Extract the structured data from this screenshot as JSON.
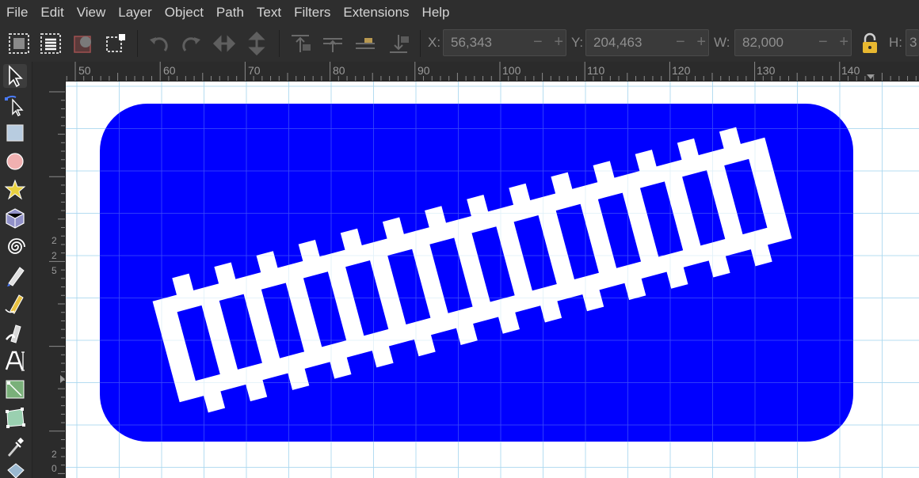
{
  "menu": [
    "File",
    "Edit",
    "View",
    "Layer",
    "Object",
    "Path",
    "Text",
    "Filters",
    "Extensions",
    "Help"
  ],
  "toolbar": {
    "x_label": "X:",
    "x_value": "56,343",
    "y_label": "Y:",
    "y_value": "204,463",
    "w_label": "W:",
    "w_value": "82,000",
    "h_label": "H:",
    "h_value": "3"
  },
  "ruler": {
    "horizontal_labels": [
      "50",
      "60",
      "70",
      "80",
      "90",
      "100",
      "110",
      "120",
      "130",
      "140"
    ],
    "vertical_labels_top": [
      "2",
      "2",
      "5"
    ],
    "vertical_labels_bottom": [
      "2",
      "0"
    ]
  },
  "tools": [
    "selector-tool",
    "node-tool",
    "rectangle-tool",
    "ellipse-tool",
    "star-tool",
    "box3d-tool",
    "spiral-tool",
    "pencil-tool",
    "pen-tool",
    "calligraphy-tool",
    "text-tool",
    "gradient-tool",
    "mesh-tool",
    "dropper-tool",
    "paint-bucket-tool"
  ],
  "colors": {
    "sign_blue": "#0000ff",
    "track_white": "#ffffff",
    "guide_grid": "#a8d8f0",
    "ui_bg": "#2e2e2e"
  },
  "drawing": {
    "object": "blue rounded sign with railway track",
    "sleepers_count": 14
  }
}
